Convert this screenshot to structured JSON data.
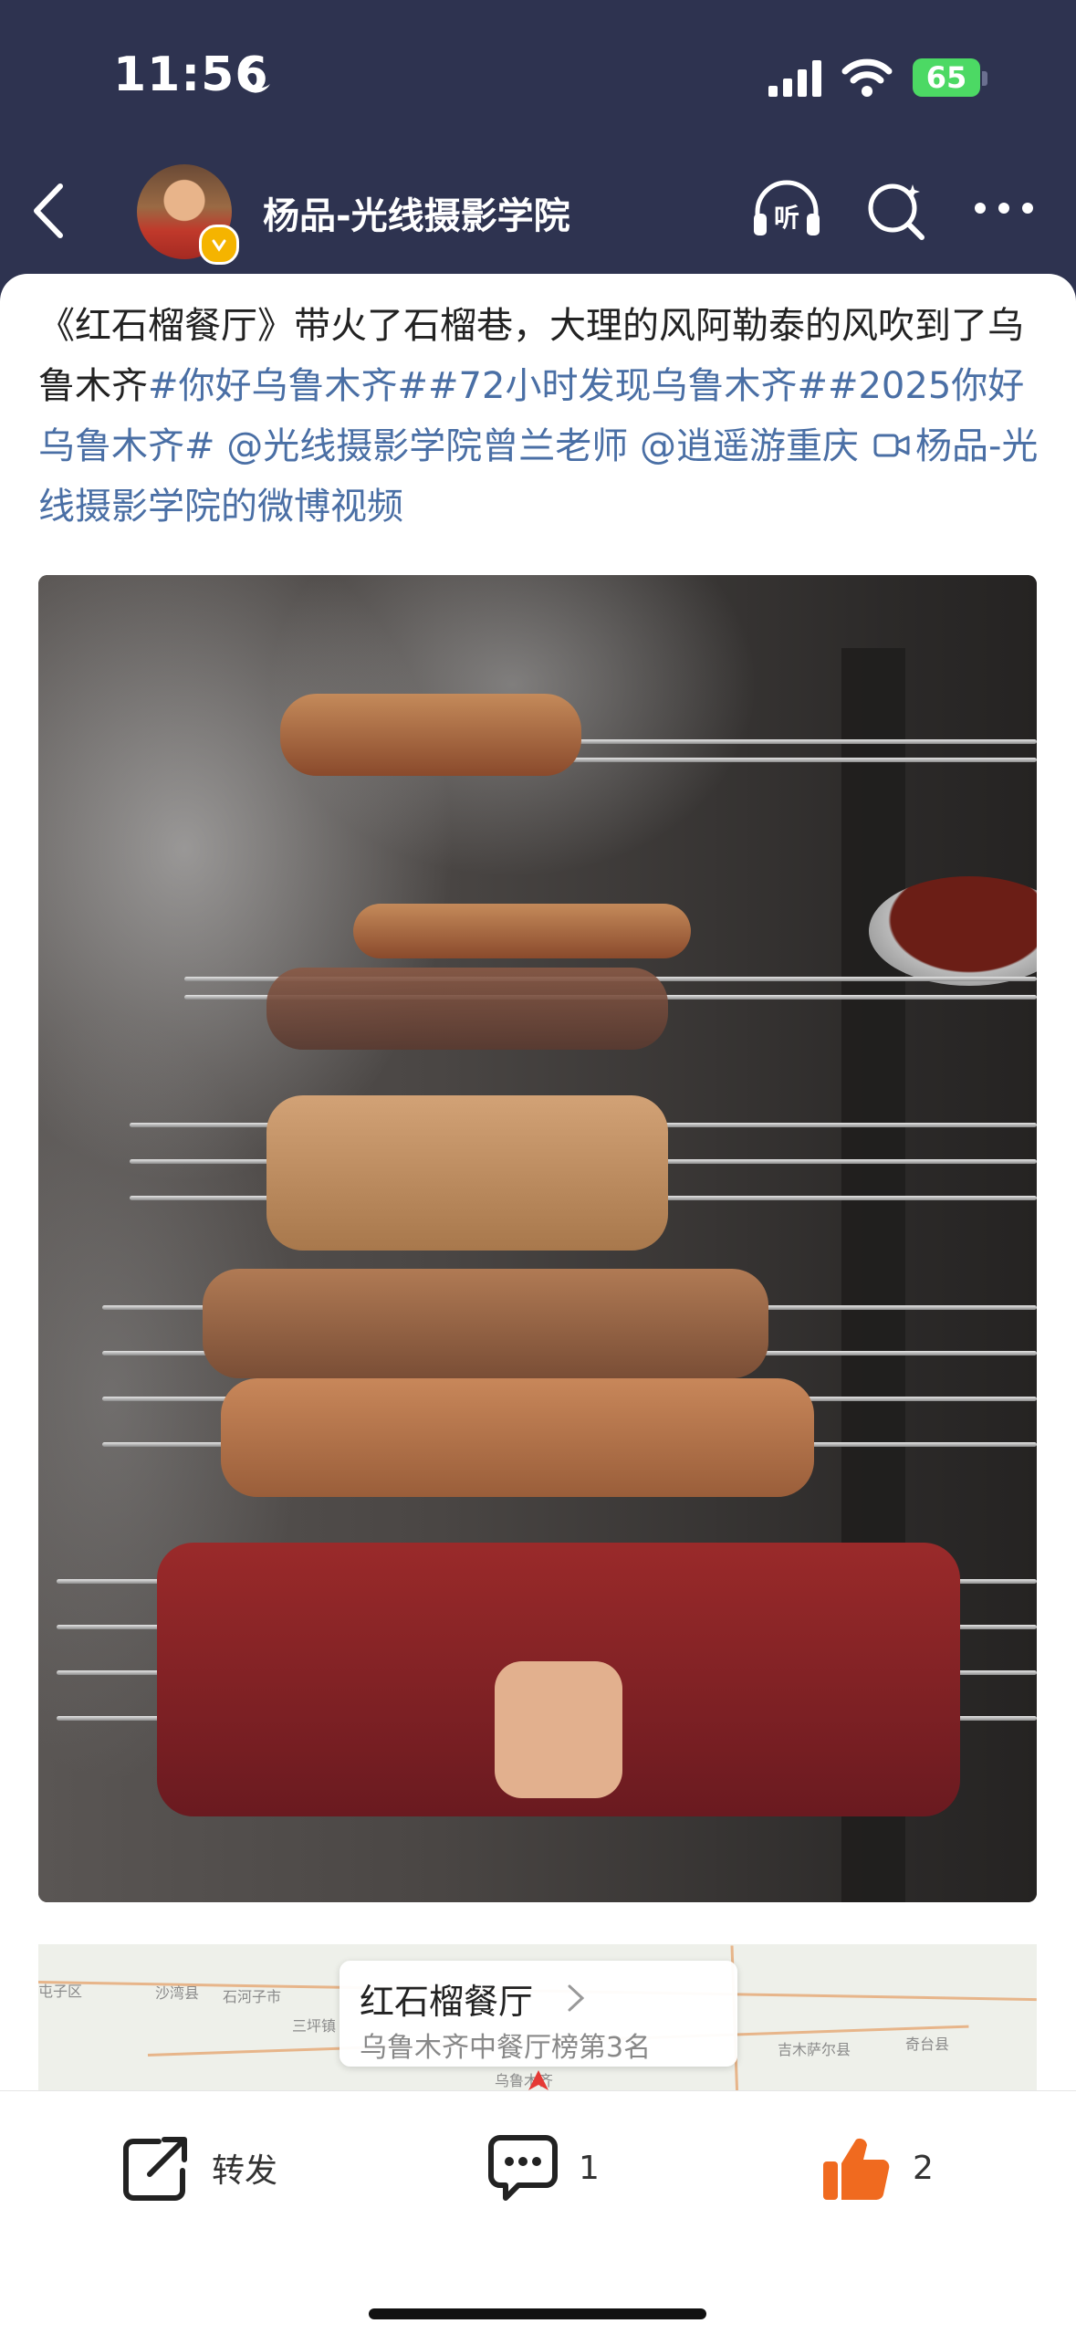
{
  "status_bar": {
    "time": "11:56",
    "battery": "65"
  },
  "nav": {
    "title": "杨品-光线摄影学院"
  },
  "post": {
    "segments": [
      {
        "text": "《红石榴餐厅》带火了石榴巷，大理的风阿勒泰的风吹到了乌鲁木齐",
        "type": "text"
      },
      {
        "text": "#你好乌鲁木齐#",
        "type": "tag"
      },
      {
        "text": "#72小时发现乌鲁木齐#",
        "type": "tag"
      },
      {
        "text": "#2025你好乌鲁木齐#",
        "type": "tag"
      },
      {
        "text": " ",
        "type": "text"
      },
      {
        "text": "@光线摄影学院曾兰老师",
        "type": "tag"
      },
      {
        "text": " ",
        "type": "text"
      },
      {
        "text": "@逍遥游重庆",
        "type": "tag"
      }
    ],
    "video_link": "杨品-光线摄影学院的微博视频"
  },
  "map": {
    "place_name": "红石榴餐厅",
    "rank": "乌鲁木齐中餐厅榜第3名",
    "labels": [
      "屯子区",
      "沙湾县",
      "石河子市",
      "三坪镇",
      "乌鲁木齐",
      "吉木萨尔县",
      "奇台县"
    ]
  },
  "actions": {
    "repost": "转发",
    "comments": "1",
    "likes": "2"
  },
  "colors": {
    "accent_link": "#4a6fa5",
    "like": "#f06a1f",
    "header_bg": "#2e3350"
  },
  "icons": [
    "moon-icon",
    "signal-icon",
    "wifi-icon",
    "back-icon",
    "listen-icon",
    "search-icon",
    "more-icon",
    "video-icon",
    "chevron-right-icon",
    "repost-icon",
    "comment-icon",
    "like-icon"
  ]
}
